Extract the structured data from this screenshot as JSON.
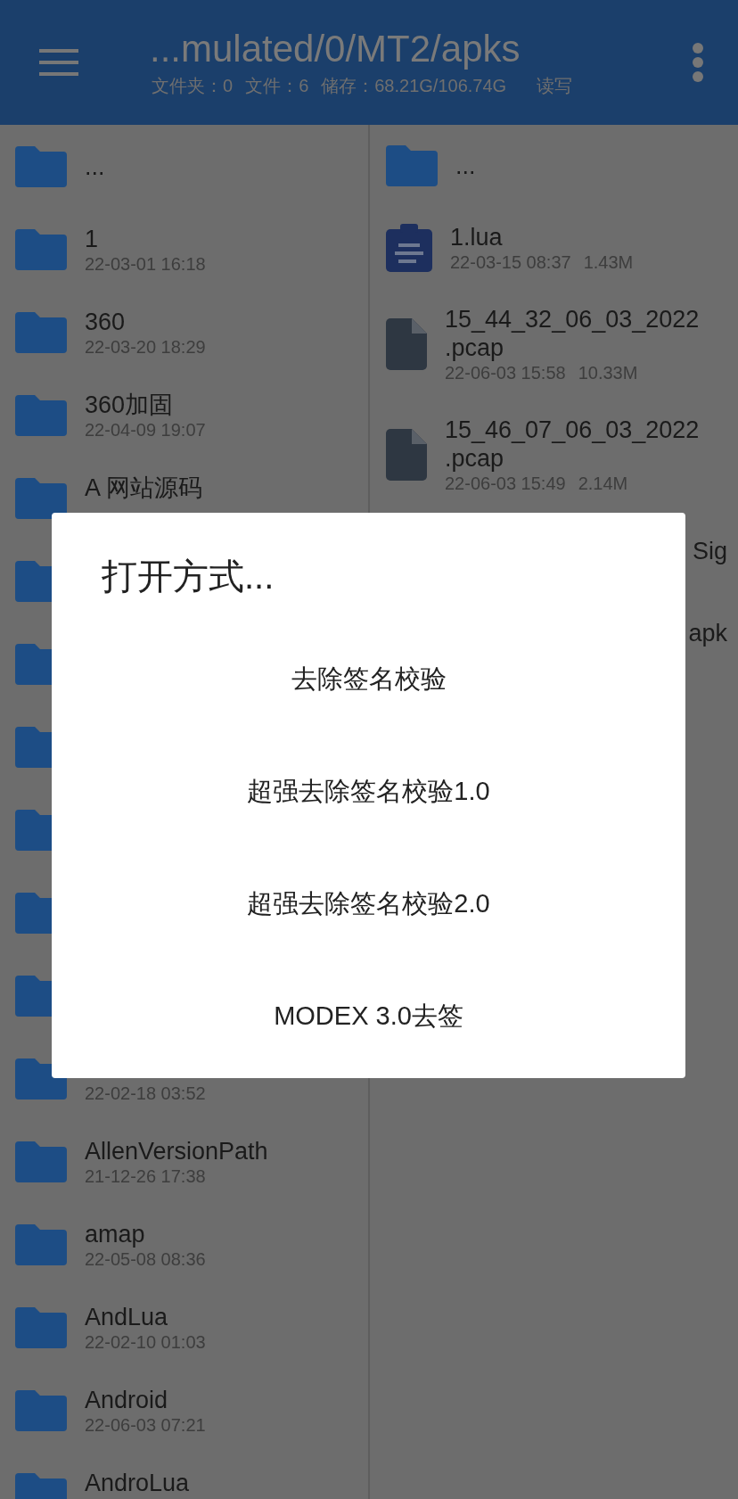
{
  "header": {
    "title": "...mulated/0/MT2/apks",
    "subtitle_parts": [
      "文件夹：0",
      "文件：6",
      "储存：68.21G/106.74G",
      "读写"
    ]
  },
  "left_panel": {
    "items": [
      {
        "kind": "folder",
        "name": "..."
      },
      {
        "kind": "folder",
        "name": "1",
        "date": "22-03-01 16:18"
      },
      {
        "kind": "folder",
        "name": "360",
        "date": "22-03-20 18:29"
      },
      {
        "kind": "folder",
        "name": "360加固",
        "date": "22-04-09 19:07"
      },
      {
        "kind": "folder",
        "name": "A 网站源码"
      },
      {
        "kind": "folder"
      },
      {
        "kind": "folder"
      },
      {
        "kind": "folder"
      },
      {
        "kind": "folder"
      },
      {
        "kind": "folder"
      },
      {
        "kind": "folder"
      },
      {
        "kind": "folder",
        "date": "22-02-18 03:52"
      },
      {
        "kind": "folder",
        "name": "AllenVersionPath",
        "date": "21-12-26 17:38"
      },
      {
        "kind": "folder",
        "name": "amap",
        "date": "22-05-08 08:36"
      },
      {
        "kind": "folder",
        "name": "AndLua",
        "date": "22-02-10 01:03"
      },
      {
        "kind": "folder",
        "name": "Android",
        "date": "22-06-03 07:21"
      },
      {
        "kind": "folder",
        "name": "AndroLua"
      }
    ]
  },
  "right_panel": {
    "items": [
      {
        "kind": "folder",
        "name": "..."
      },
      {
        "kind": "lua",
        "name": "1.lua",
        "date": "22-03-15 08:37",
        "size": "1.43M"
      },
      {
        "kind": "file",
        "name": "15_44_32_06_03_2022\n.pcap",
        "date": "22-06-03 15:58",
        "size": "10.33M"
      },
      {
        "kind": "file",
        "name": "15_46_07_06_03_2022\n.pcap",
        "date": "22-06-03 15:49",
        "size": "2.14M"
      },
      {
        "kind": "hidden",
        "name": "Sig"
      },
      {
        "kind": "hidden",
        "name": "apk"
      }
    ]
  },
  "dialog": {
    "title": "打开方式...",
    "options": [
      "去除签名校验",
      "超强去除签名校验1.0",
      "超强去除签名校验2.0",
      "MODEX 3.0去签"
    ]
  }
}
